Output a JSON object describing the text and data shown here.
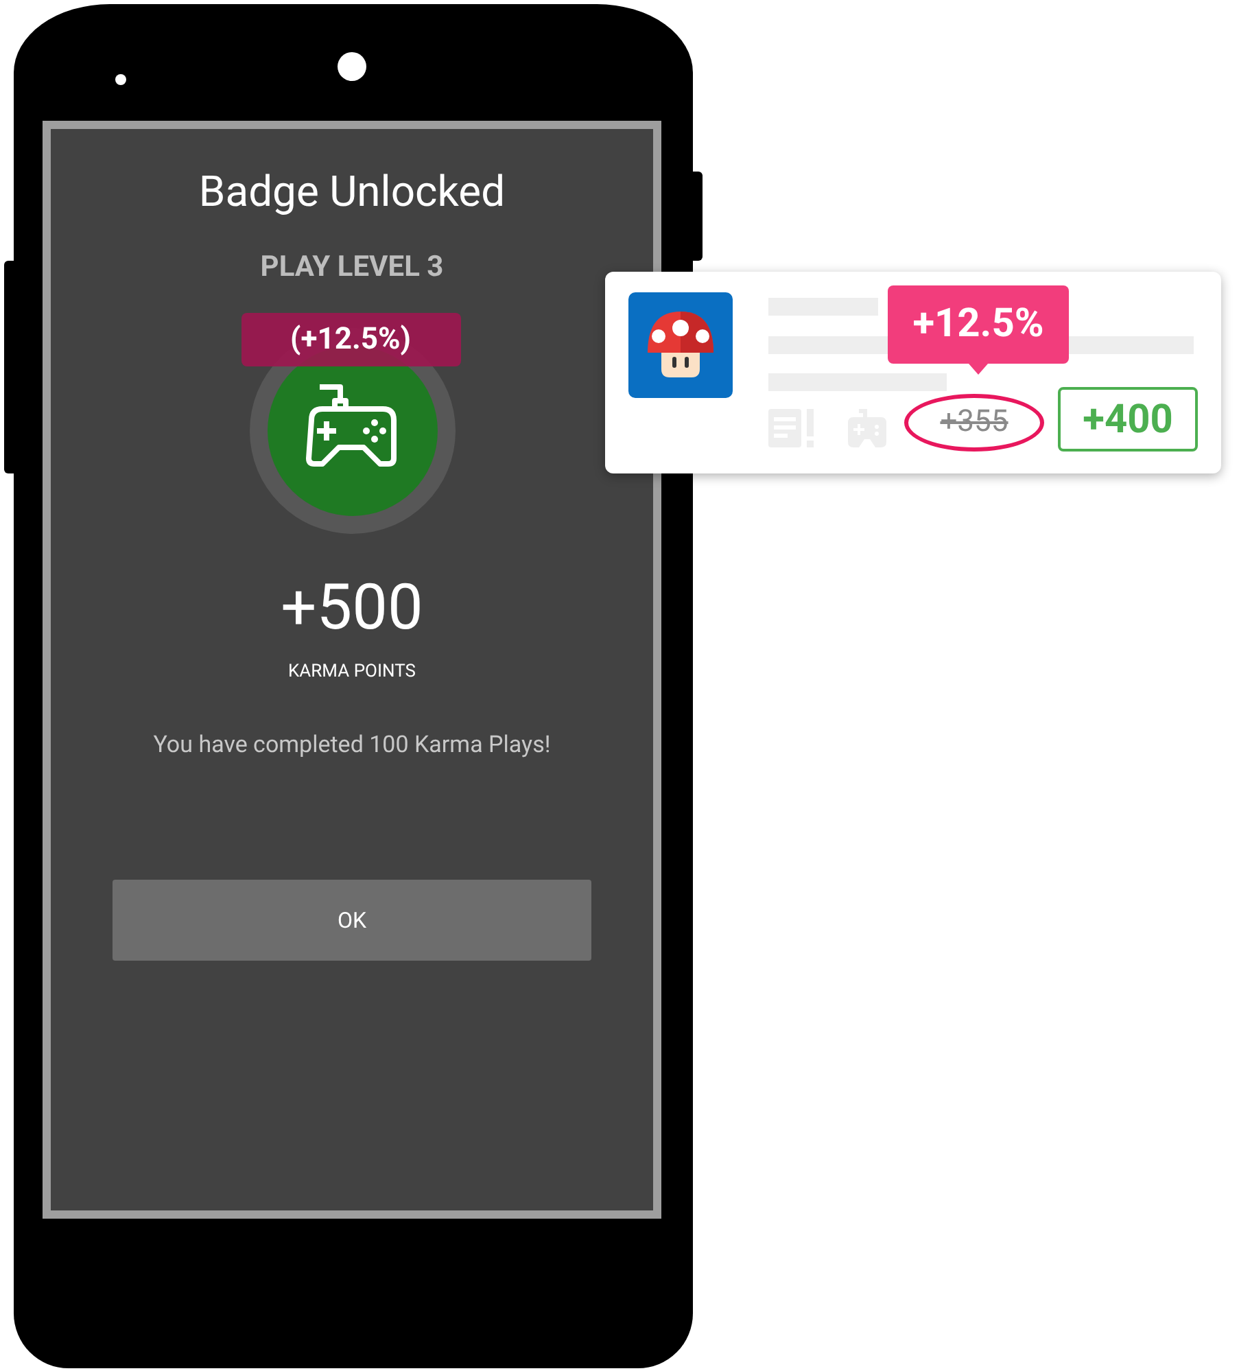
{
  "dialog": {
    "title": "Badge Unlocked",
    "subtitle": "PLAY LEVEL 3",
    "bonus_label": "(+12.5%)",
    "points": "+500",
    "points_label": "KARMA POINTS",
    "message": "You have completed 100 Karma Plays!",
    "button": "OK"
  },
  "card": {
    "tooltip": "+12.5%",
    "old_points": "+355",
    "old_struck": true,
    "new_points": "+400"
  }
}
